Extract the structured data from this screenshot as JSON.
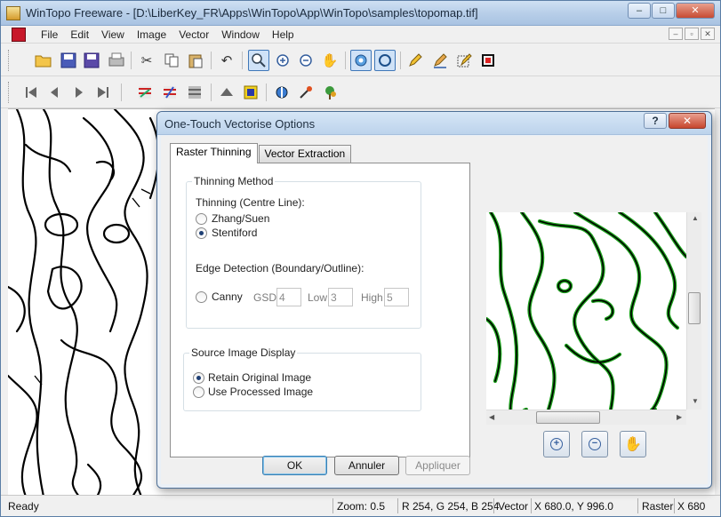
{
  "app": {
    "title": "WinTopo Freeware - [D:\\LiberKey_FR\\Apps\\WinTopo\\App\\WinTopo\\samples\\topomap.tif]",
    "window_controls": [
      "–",
      "□",
      "✕"
    ]
  },
  "menu": {
    "items": [
      "File",
      "Edit",
      "View",
      "Image",
      "Vector",
      "Window",
      "Help"
    ],
    "mdi_controls": [
      "–",
      "▫",
      "✕"
    ]
  },
  "toolbar1": {
    "buttons": [
      "open-folder",
      "save",
      "save-all",
      "print",
      "cut",
      "copy",
      "paste",
      "undo",
      "zoom-tool",
      "zoom-in",
      "zoom-out",
      "pan-hand",
      "raster-view",
      "vector-view",
      "pencil",
      "eraser-pen",
      "edit-box",
      "crop"
    ]
  },
  "toolbar2": {
    "buttons": [
      "first",
      "previous",
      "next",
      "last",
      "vectorise-1",
      "vectorise-2",
      "vectorise-3",
      "layer-1",
      "layer-2",
      "shield",
      "wand",
      "tree"
    ]
  },
  "status": {
    "ready": "Ready",
    "zoom": "Zoom: 0.5",
    "rgb": "R 254, G 254, B 254",
    "vector_label": "Vector",
    "vector_coords": "X 680.0, Y 996.0",
    "raster_label": "Raster",
    "raster_coords": "X 680"
  },
  "dialog": {
    "title": "One-Touch Vectorise Options",
    "help": "?",
    "close": "✕",
    "tabs": [
      "Raster Thinning",
      "Vector Extraction"
    ],
    "thinning": {
      "group_label": "Thinning Method",
      "centre_line_label": "Thinning (Centre Line):",
      "options": [
        {
          "label": "Zhang/Suen",
          "checked": false
        },
        {
          "label": "Stentiford",
          "checked": true
        }
      ],
      "edge_label": "Edge Detection (Boundary/Outline):",
      "canny": {
        "label": "Canny",
        "checked": false
      },
      "gsd_label": "GSD",
      "gsd_value": "4",
      "low_label": "Low",
      "low_value": "3",
      "high_label": "High",
      "high_value": "5"
    },
    "source": {
      "group_label": "Source Image Display",
      "options": [
        {
          "label": "Retain Original Image",
          "checked": true
        },
        {
          "label": "Use Processed Image",
          "checked": false
        }
      ]
    },
    "zoom_buttons": [
      "zoom-in",
      "zoom-out",
      "pan-hand"
    ],
    "buttons": {
      "ok": "OK",
      "cancel": "Annuler",
      "apply": "Appliquer"
    },
    "preview_scroll": {
      "h_grip": "|||",
      "v_grip": "≡"
    }
  },
  "colors": {
    "title_bg": "#b8cfe9",
    "contour": "#000000",
    "vector_overlay": "#1aa01a",
    "default_button_border": "#3c7fb1"
  }
}
